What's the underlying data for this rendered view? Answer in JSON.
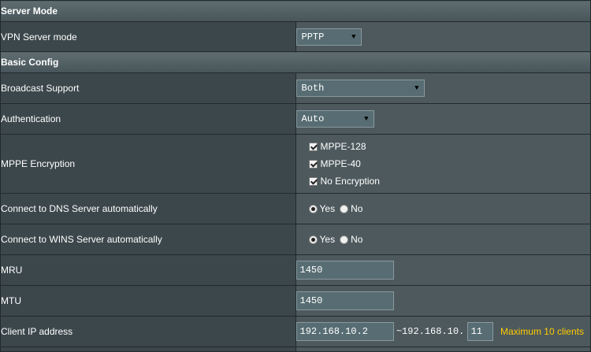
{
  "sections": {
    "server_mode": "Server Mode",
    "basic_config": "Basic Config"
  },
  "vpn_server_mode": {
    "label": "VPN Server mode",
    "value": "PPTP"
  },
  "broadcast_support": {
    "label": "Broadcast Support",
    "value": "Both"
  },
  "authentication": {
    "label": "Authentication",
    "value": "Auto"
  },
  "mppe_encryption": {
    "label": "MPPE Encryption",
    "options": [
      {
        "label": "MPPE-128",
        "checked": true
      },
      {
        "label": "MPPE-40",
        "checked": true
      },
      {
        "label": "No Encryption",
        "checked": true
      }
    ]
  },
  "dns_auto": {
    "label": "Connect to DNS Server automatically",
    "yes": "Yes",
    "no": "No",
    "selected": "Yes"
  },
  "wins_auto": {
    "label": "Connect to WINS Server automatically",
    "yes": "Yes",
    "no": "No",
    "selected": "Yes"
  },
  "mru": {
    "label": "MRU",
    "value": "1450"
  },
  "mtu": {
    "label": "MTU",
    "value": "1450"
  },
  "client_ip": {
    "label": "Client IP address",
    "start": "192.168.10.2",
    "separator": "~",
    "prefix": "192.168.10.",
    "end": "11",
    "note": "Maximum 10 clients"
  },
  "colors": {
    "note": "#ffcc00",
    "label_bg": "#3c474b",
    "value_bg": "#4d595d"
  }
}
